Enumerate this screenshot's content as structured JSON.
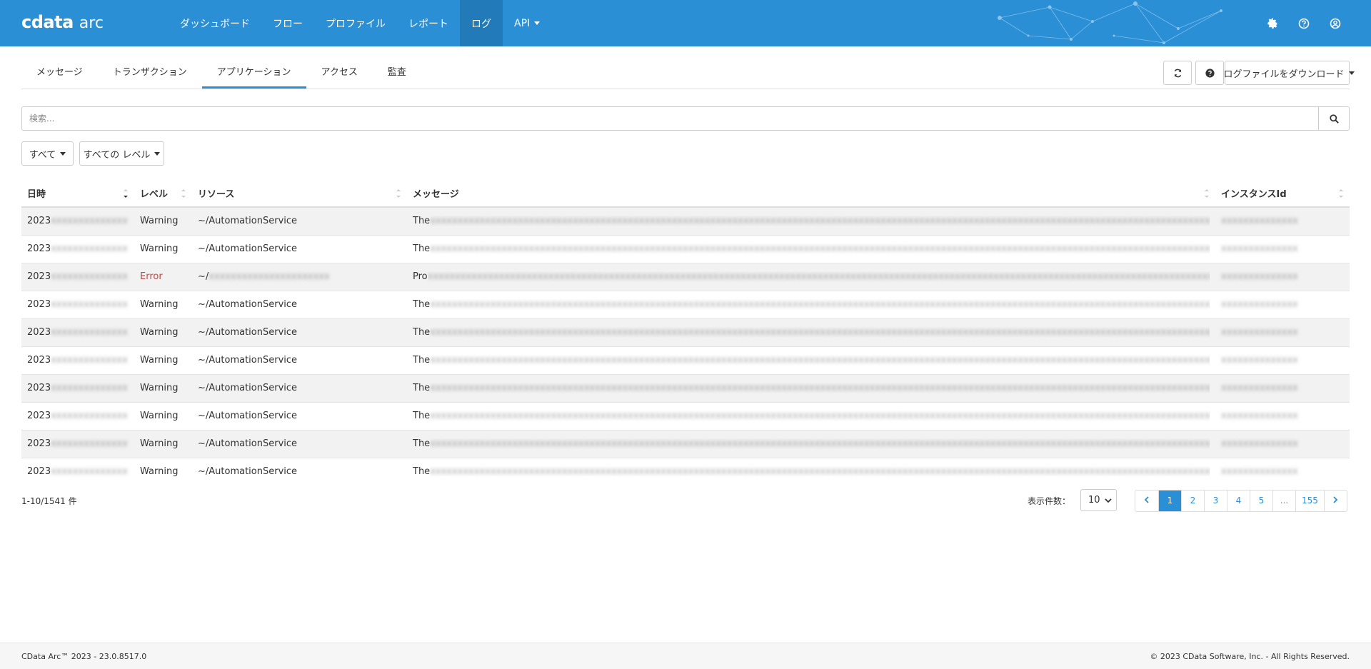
{
  "brand": {
    "logo": "cdata",
    "product": "arc"
  },
  "nav": {
    "items": [
      "ダッシュボード",
      "フロー",
      "プロファイル",
      "レポート",
      "ログ",
      "API"
    ],
    "active_index": 4
  },
  "colors": {
    "primary": "#2b8fd6",
    "nav_active": "#237ab8",
    "error": "#b94a48"
  },
  "tabs": {
    "items": [
      "メッセージ",
      "トランザクション",
      "アプリケーション",
      "アクセス",
      "監査"
    ],
    "active_index": 2
  },
  "toolbar": {
    "download_label": "ログファイルをダウンロード"
  },
  "search": {
    "placeholder": "検索..."
  },
  "filters": {
    "scope": "すべて",
    "level": "すべての レベル"
  },
  "table": {
    "headers": {
      "date": "日時",
      "level": "レベル",
      "resource": "リソース",
      "message": "メッセージ",
      "instance": "インスタンスId"
    },
    "rows": [
      {
        "date": "2023",
        "level": "Warning",
        "resource": "~/AutomationService",
        "msg_prefix": "The",
        "is_error": false
      },
      {
        "date": "2023",
        "level": "Warning",
        "resource": "~/AutomationService",
        "msg_prefix": "The",
        "is_error": false
      },
      {
        "date": "2023",
        "level": "Error",
        "resource": "~/",
        "msg_prefix": "Pro",
        "is_error": true
      },
      {
        "date": "2023",
        "level": "Warning",
        "resource": "~/AutomationService",
        "msg_prefix": "The",
        "is_error": false
      },
      {
        "date": "2023",
        "level": "Warning",
        "resource": "~/AutomationService",
        "msg_prefix": "The",
        "is_error": false
      },
      {
        "date": "2023",
        "level": "Warning",
        "resource": "~/AutomationService",
        "msg_prefix": "The",
        "is_error": false
      },
      {
        "date": "2023",
        "level": "Warning",
        "resource": "~/AutomationService",
        "msg_prefix": "The",
        "is_error": false
      },
      {
        "date": "2023",
        "level": "Warning",
        "resource": "~/AutomationService",
        "msg_prefix": "The",
        "is_error": false
      },
      {
        "date": "2023",
        "level": "Warning",
        "resource": "~/AutomationService",
        "msg_prefix": "The",
        "is_error": false
      },
      {
        "date": "2023",
        "level": "Warning",
        "resource": "~/AutomationService",
        "msg_prefix": "The",
        "is_error": false
      }
    ]
  },
  "pagination": {
    "count_text": "1-10/1541 件",
    "page_size_label": "表示件数：",
    "page_size": "10",
    "pages": [
      "1",
      "2",
      "3",
      "4",
      "5",
      "...",
      "155"
    ],
    "current": "1"
  },
  "footer": {
    "version": "CData Arc™ 2023 - 23.0.8517.0",
    "copyright": "© 2023 CData Software, Inc. - All Rights Reserved."
  }
}
